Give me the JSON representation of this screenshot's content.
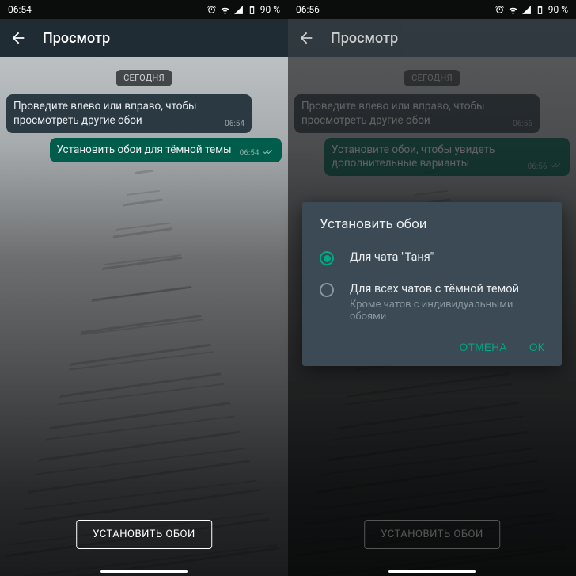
{
  "screens": [
    {
      "time": "06:54",
      "battery": "90 %",
      "title": "Просмотр",
      "date_chip": "СЕГОДНЯ",
      "messages": [
        {
          "dir": "in",
          "text": "Проведите влево или вправо, чтобы просмотреть другие обои",
          "time": "06:54"
        },
        {
          "dir": "out",
          "text": "Установить обои для тёмной темы",
          "time": "06:54"
        }
      ],
      "button": "УСТАНОВИТЬ ОБОИ"
    },
    {
      "time": "06:56",
      "battery": "90 %",
      "title": "Просмотр",
      "date_chip": "СЕГОДНЯ",
      "messages": [
        {
          "dir": "in",
          "text": "Проведите влево или вправо, чтобы просмотреть другие обои",
          "time": "06:56"
        },
        {
          "dir": "out",
          "text": "Установите обои, чтобы увидеть дополнительные варианты",
          "time": "06:56"
        }
      ],
      "button": "УСТАНОВИТЬ ОБОИ",
      "dialog": {
        "title": "Установить обои",
        "options": [
          {
            "label": "Для чата \"Таня\"",
            "selected": true
          },
          {
            "label": "Для всех чатов с тёмной темой",
            "sub": "Кроме чатов с индивидуальными обоями",
            "selected": false
          }
        ],
        "cancel": "ОТМЕНА",
        "ok": "ОК"
      }
    }
  ]
}
